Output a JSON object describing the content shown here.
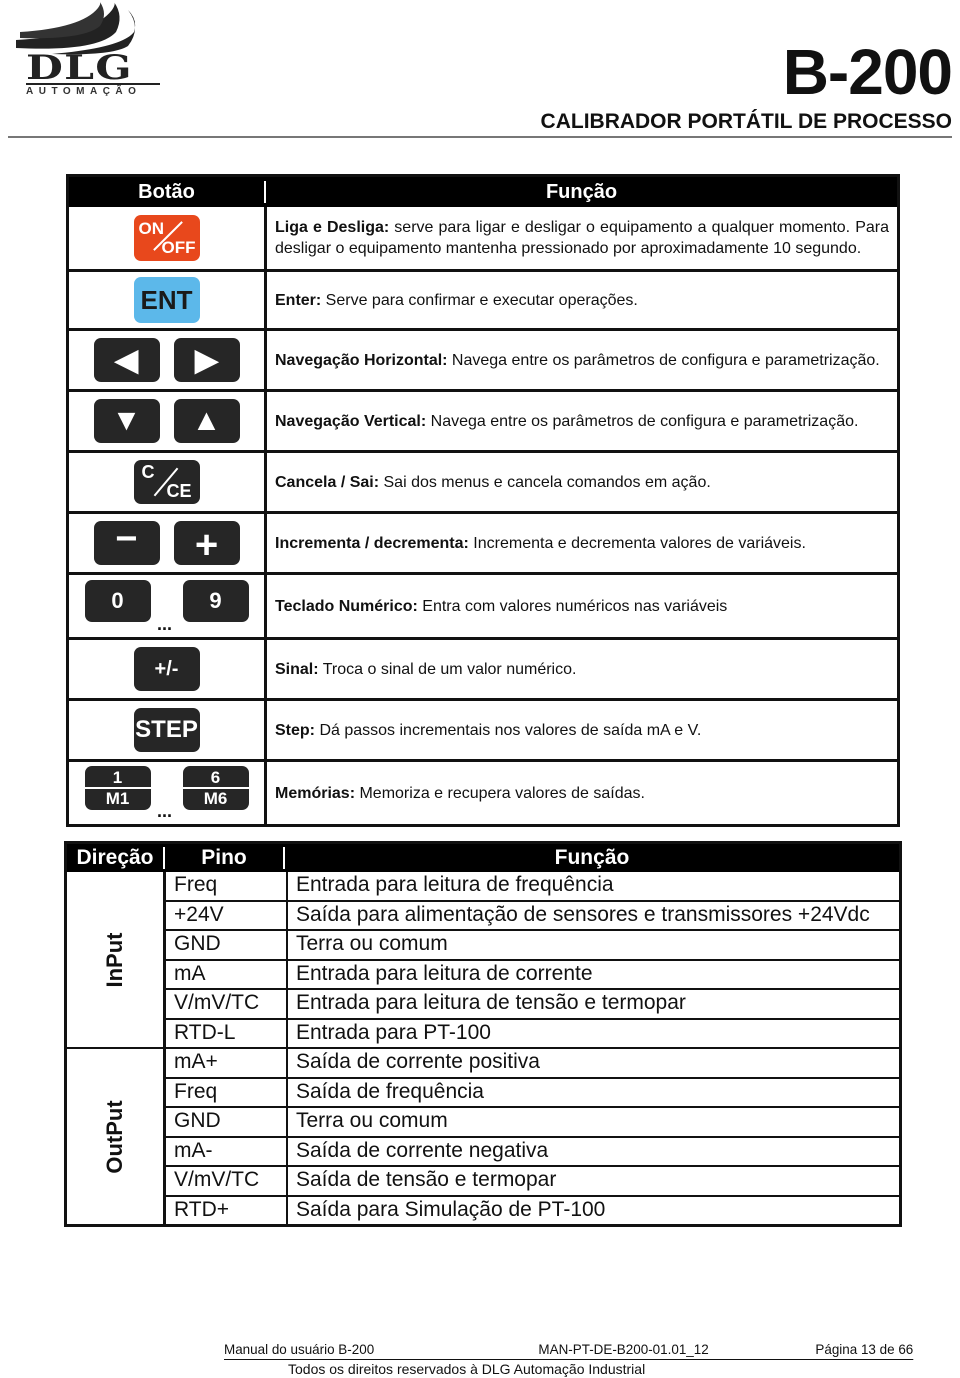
{
  "header": {
    "logo_text": "DLG",
    "logo_subtext": "AUTOMAÇÃO",
    "model": "B-200",
    "subtitle": "CALIBRADOR PORTÁTIL DE PROCESSO"
  },
  "buttons_table": {
    "headers": {
      "button": "Botão",
      "function": "Função"
    },
    "rows": [
      {
        "keys": [
          "ON/OFF"
        ],
        "bold": "Liga e Desliga:",
        "text": " serve para ligar e desligar o equipamento a qualquer momento. Para desligar o equipamento mantenha pressionado por aproximadamente 10 segundo."
      },
      {
        "keys": [
          "ENT"
        ],
        "bold": "Enter:",
        "text": " Serve para confirmar e executar operações."
      },
      {
        "keys": [
          "◀",
          "▶"
        ],
        "bold": "Navegação Horizontal:",
        "text": " Navega entre os parâmetros de configura e parametrização."
      },
      {
        "keys": [
          "▼",
          "▲"
        ],
        "bold": "Navegação Vertical:",
        "text": " Navega entre os parâmetros de configura e parametrização."
      },
      {
        "keys": [
          "C/CE"
        ],
        "bold": "Cancela / Sai:",
        "text": " Sai dos menus e cancela comandos em ação."
      },
      {
        "keys": [
          "−",
          "+"
        ],
        "bold": "Incrementa / decrementa:",
        "text": " Incrementa e decrementa valores de variáveis."
      },
      {
        "keys": [
          "0",
          "9"
        ],
        "separator": "...",
        "bold": "Teclado Numérico:",
        "text": " Entra com valores numéricos nas variáveis"
      },
      {
        "keys": [
          "+/-"
        ],
        "bold": "Sinal:",
        "text": " Troca o sinal de um valor numérico."
      },
      {
        "keys": [
          "STEP"
        ],
        "bold": "Step:",
        "text": " Dá passos incrementais nos valores de saída mA e V."
      },
      {
        "keys": [
          {
            "top": "1",
            "bottom": "M1"
          },
          {
            "top": "6",
            "bottom": "M6"
          }
        ],
        "separator": "...",
        "bold": "Memórias:",
        "text": " Memoriza e recupera valores de saídas."
      }
    ]
  },
  "pins_table": {
    "headers": {
      "direction": "Direção",
      "pin": "Pino",
      "function": "Função"
    },
    "groups": [
      {
        "direction": "InPut",
        "rows": [
          {
            "pin": "Freq",
            "function": "Entrada para leitura de frequência"
          },
          {
            "pin": "+24V",
            "function": "Saída para alimentação de sensores e transmissores +24Vdc"
          },
          {
            "pin": "GND",
            "function": "Terra ou comum"
          },
          {
            "pin": "mA",
            "function": "Entrada para leitura de corrente"
          },
          {
            "pin": "V/mV/TC",
            "function": "Entrada para leitura de tensão e termopar"
          },
          {
            "pin": "RTD-L",
            "function": "Entrada para PT-100"
          }
        ]
      },
      {
        "direction": "OutPut",
        "rows": [
          {
            "pin": "mA+",
            "function": "Saída de corrente positiva"
          },
          {
            "pin": "Freq",
            "function": "Saída de frequência"
          },
          {
            "pin": "GND",
            "function": "Terra ou comum"
          },
          {
            "pin": "mA-",
            "function": "Saída de corrente negativa"
          },
          {
            "pin": "V/mV/TC",
            "function": "Saída de tensão e termopar"
          },
          {
            "pin": "RTD+",
            "function": "Saída para Simulação de PT-100"
          }
        ]
      }
    ]
  },
  "footer": {
    "manual": "Manual do usuário B-200",
    "doc_code": "MAN-PT-DE-B200-01.01_12",
    "page": "Página 13 de 66",
    "rights": "Todos os direitos reservados à DLG Automação Industrial"
  },
  "colors": {
    "onoff": "#e8481c",
    "ent": "#5cb8ea",
    "key": "#262626"
  }
}
